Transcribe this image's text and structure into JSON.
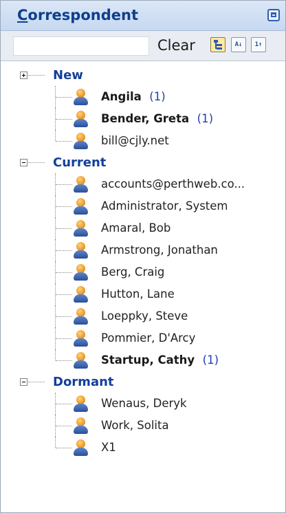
{
  "header": {
    "title_first": "C",
    "title_rest": "orrespondent"
  },
  "toolbar": {
    "search_value": "",
    "clear_label": "Clear",
    "btn_sort_az": "A↓",
    "btn_sort_num": "1↑"
  },
  "groups": [
    {
      "label": "New",
      "expander": "+",
      "items": [
        {
          "label": "Angila",
          "count": "(1)",
          "bold": true
        },
        {
          "label": "Bender, Greta",
          "count": "(1)",
          "bold": true
        },
        {
          "label": "bill@cjly.net",
          "count": "",
          "bold": false
        }
      ]
    },
    {
      "label": "Current",
      "expander": "-",
      "items": [
        {
          "label": "accounts@perthweb.co...",
          "count": "",
          "bold": false
        },
        {
          "label": "Administrator, System",
          "count": "",
          "bold": false
        },
        {
          "label": "Amaral, Bob",
          "count": "",
          "bold": false
        },
        {
          "label": "Armstrong, Jonathan",
          "count": "",
          "bold": false
        },
        {
          "label": "Berg, Craig",
          "count": "",
          "bold": false
        },
        {
          "label": "Hutton, Lane",
          "count": "",
          "bold": false
        },
        {
          "label": "Loeppky, Steve",
          "count": "",
          "bold": false
        },
        {
          "label": "Pommier, D'Arcy",
          "count": "",
          "bold": false
        },
        {
          "label": "Startup, Cathy",
          "count": "(1)",
          "bold": true
        }
      ]
    },
    {
      "label": "Dormant",
      "expander": "-",
      "items": [
        {
          "label": "Wenaus, Deryk",
          "count": "",
          "bold": false
        },
        {
          "label": "Work, Solita",
          "count": "",
          "bold": false
        },
        {
          "label": "X1",
          "count": "",
          "bold": false
        }
      ]
    }
  ]
}
